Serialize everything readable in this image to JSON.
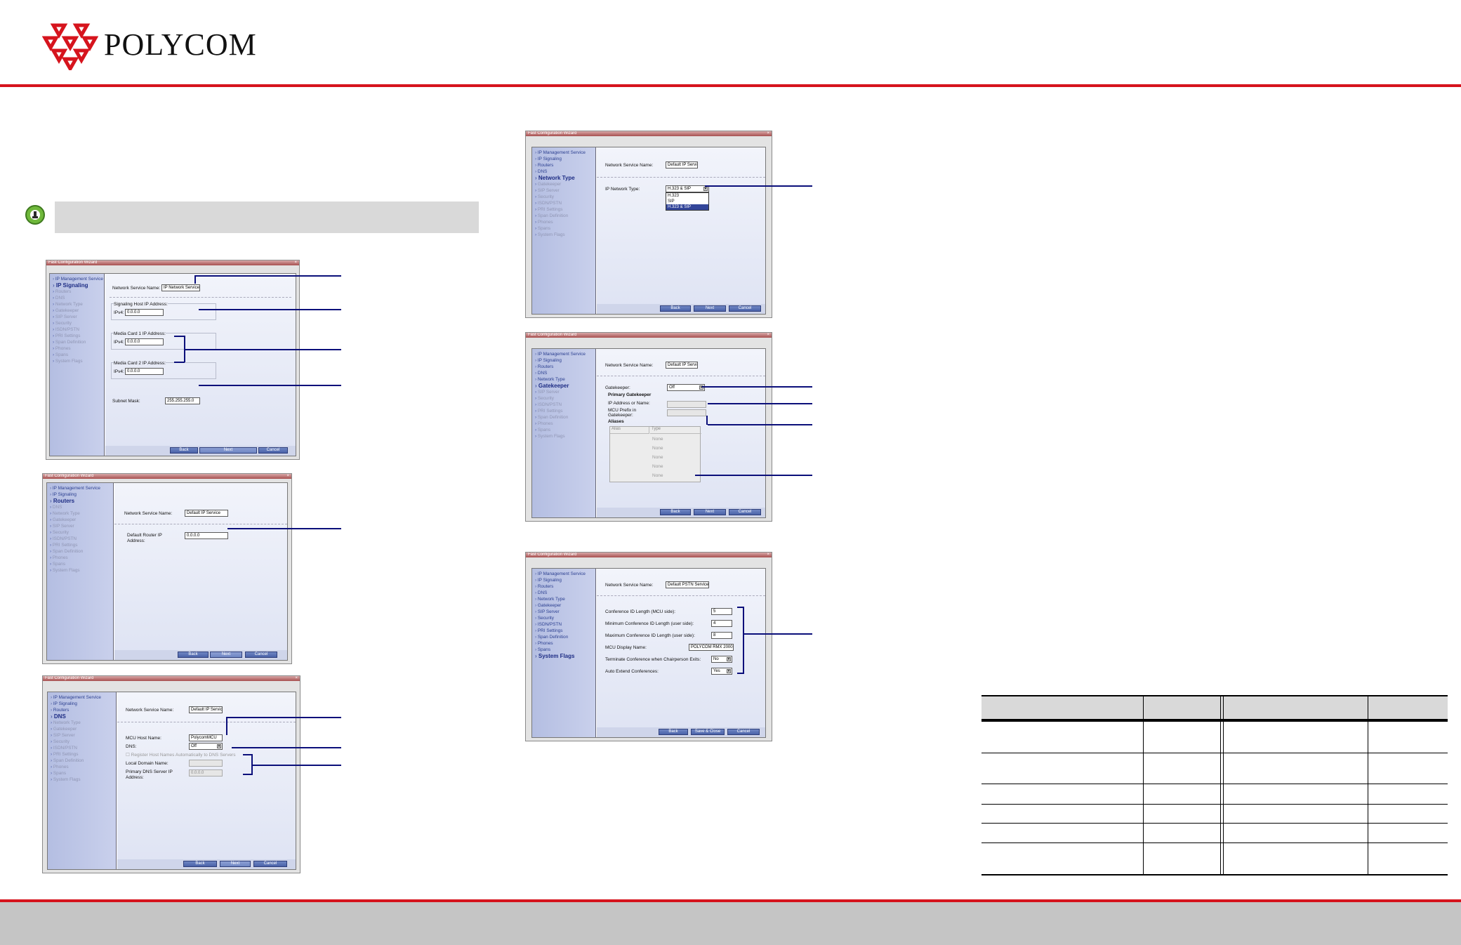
{
  "brand": {
    "name": "POLYCOM",
    "logo_color": "#d6141d",
    "line_color": "#d6141d",
    "footer_color": "#c5c5c5",
    "callout_color": "#0b0f7a"
  },
  "menu": [
    "IP Management Service",
    "IP Signaling",
    "Routers",
    "DNS",
    "Network Type",
    "Gatekeeper",
    "SIP Server",
    "Security",
    "ISDN/PSTN",
    "PRI Settings",
    "Span Definition",
    "Phones",
    "Spans",
    "System Flags"
  ],
  "wizard_title": "Fast Configuration Wizard",
  "buttons": {
    "back": "Back",
    "next": "Next",
    "cancel": "Cancel",
    "save_close": "Save & Close"
  },
  "w1": {
    "service_label": "Network Service Name:",
    "service_value": "IP Network Service",
    "signaling_label": "Signaling Host IP Address:",
    "ipv4": "IPv4:",
    "ip0": "0.0.0.0",
    "mc1_label": "Media Card 1 IP Address:",
    "mc2_label": "Media Card 2 IP Address:",
    "subnet_label": "Subnet Mask:",
    "subnet_value": "255.255.255.0"
  },
  "w2": {
    "service_label": "Network Service Name:",
    "service_value": "Default IP Service",
    "router_label1": "Default Router IP",
    "router_label2": "Address:",
    "router_value": "0.0.0.0"
  },
  "w3": {
    "service_label": "Network Service Name:",
    "service_value": "Default IP Service",
    "host_label": "MCU Host Name:",
    "host_value": "PolycomMCU",
    "dns_label": "DNS:",
    "dns_value": "Off",
    "register_label": "Register Host Names Automatically to DNS Servers",
    "domain_label": "Local Domain Name:",
    "primary_label1": "Primary DNS Server IP",
    "primary_label2": "Address:",
    "primary_value": "0.0.0.0"
  },
  "w4": {
    "service_label": "Network Service Name:",
    "service_value": "Default IP Service",
    "type_label": "IP Network Type:",
    "type_value": "H.323 & SIP",
    "options": [
      "H.323",
      "SIP",
      "H.323 & SIP"
    ]
  },
  "w5": {
    "service_label": "Network Service Name:",
    "service_value": "Default IP Service",
    "gk_label": "Gatekeeper:",
    "gk_value": "Off",
    "primary_gk": "Primary Gatekeeper",
    "ip_label": "IP Address or Name:",
    "prefix_label1": "MCU Prefix in",
    "prefix_label2": "Gatekeeper:",
    "aliases": "Aliases",
    "alias_cols": [
      "Alias",
      "Type"
    ],
    "alias_type": "None"
  },
  "w6": {
    "service_label": "Network Service Name:",
    "service_value": "Default PSTN Service",
    "rows": [
      {
        "label": "Conference ID Length (MCU side):",
        "value": "5"
      },
      {
        "label": "Minimum Conference ID Length (user side):",
        "value": "4"
      },
      {
        "label": "Maximum Conference ID Length (user side):",
        "value": "8"
      },
      {
        "label": "MCU Display Name:",
        "value": "POLYCOM RMX 2000"
      },
      {
        "label": "Terminate Conference when Chairperson Exits:",
        "value": "No"
      },
      {
        "label": "Auto Extend Conferences:",
        "value": "Yes"
      }
    ]
  }
}
